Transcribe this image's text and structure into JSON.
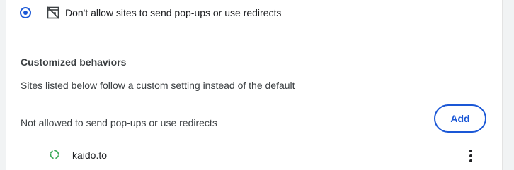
{
  "popups": {
    "default_option": {
      "label": "Don't allow sites to send pop-ups or use redirects",
      "icon": "popup-blocked-icon",
      "selected": true
    },
    "customized": {
      "title": "Customized behaviors",
      "description": "Sites listed below follow a custom setting instead of the default",
      "not_allowed": {
        "header": "Not allowed to send pop-ups or use redirects",
        "add_label": "Add",
        "sites": [
          {
            "name": "kaido.to",
            "icon": "loading-spinner-icon",
            "menu_icon": "more-vert-icon"
          }
        ]
      }
    }
  },
  "colors": {
    "accent": "#1a57d6",
    "spinner": "#34a853",
    "text": "#202124",
    "secondary_text": "#3c4043"
  }
}
